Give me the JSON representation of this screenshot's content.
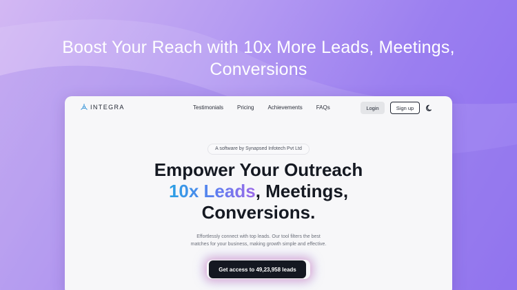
{
  "hero": {
    "headline_line1": "Boost Your Reach with 10x More Leads, Meetings,",
    "headline_line2": "Conversions"
  },
  "navbar": {
    "logo_text": "INTEGRA",
    "links": [
      "Testimonials",
      "Pricing",
      "Achievements",
      "FAQs"
    ],
    "login_label": "Login",
    "signup_label": "Sign up",
    "theme_icon": "moon-icon"
  },
  "main": {
    "badge": "A software by Synapsed Infotech Pvt Ltd",
    "headline_line1": "Empower Your Outreach",
    "headline_highlight": "10x Leads",
    "headline_line2_rest": ", Meetings,",
    "headline_line3": "Conversions.",
    "subtext_line1": "Effortlessly connect with top leads. Our tool filters the best",
    "subtext_line2": "matches for your business, making growth simple and effective.",
    "cta_label": "Get access to 49,23,958 leads"
  },
  "colors": {
    "background_start": "#d3b8f3",
    "background_end": "#8b6cf0",
    "headline_gradient_start": "#2aa1e4",
    "headline_gradient_end": "#9c6be8",
    "cta_background": "#141821",
    "logo_accent": "#2b8fd6"
  }
}
